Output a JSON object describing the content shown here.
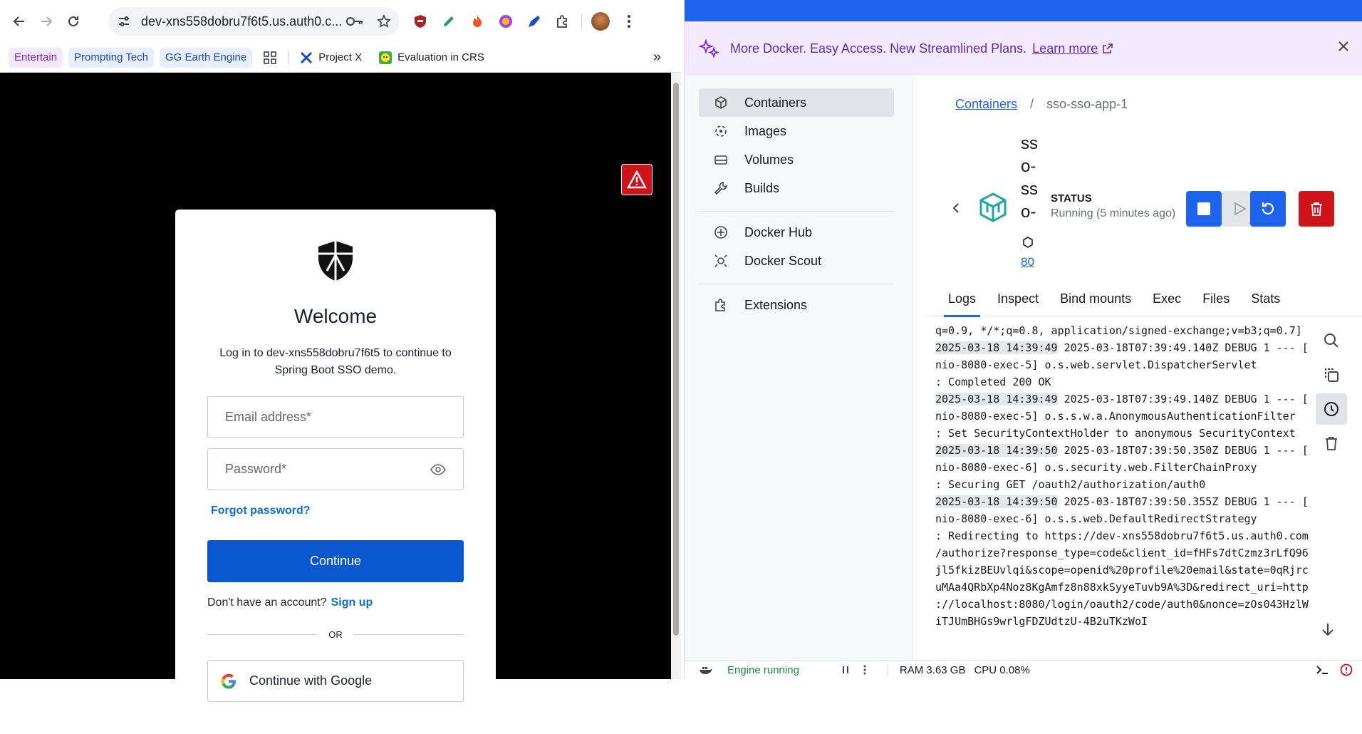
{
  "browser": {
    "url": "dev-xns558dobru7f6t5.us.auth0.c...",
    "bookmarks": [
      {
        "label": "Entertain",
        "style": "purple"
      },
      {
        "label": "Prompting Tech",
        "style": "tag"
      },
      {
        "label": "GG Earth Engine",
        "style": "tag"
      },
      {
        "label": "Project X",
        "style": "icon"
      },
      {
        "label": "Evaluation in CRS",
        "style": "icon"
      }
    ],
    "more_bookmarks": "»"
  },
  "login": {
    "title": "Welcome",
    "subtitle": "Log in to dev-xns558dobru7f6t5 to continue to Spring Boot SSO demo.",
    "email_placeholder": "Email address*",
    "password_placeholder": "Password*",
    "forgot": "Forgot password?",
    "continue": "Continue",
    "no_account": "Don't have an account?",
    "signup": "Sign up",
    "or": "OR",
    "google": "Continue with Google"
  },
  "docker": {
    "banner_text": "More Docker. Easy Access. New Streamlined Plans.",
    "banner_link": "Learn more",
    "nav": {
      "containers": "Containers",
      "images": "Images",
      "volumes": "Volumes",
      "builds": "Builds",
      "hub": "Docker Hub",
      "scout": "Docker Scout",
      "extensions": "Extensions"
    },
    "breadcrumb": {
      "root": "Containers",
      "sep": "/",
      "current": "sso-sso-app-1"
    },
    "container_name": "sso-sso-app-1",
    "port": "80",
    "status_label": "STATUS",
    "status_value": "Running (5 minutes ago)",
    "tabs": [
      "Logs",
      "Inspect",
      "Bind mounts",
      "Exec",
      "Files",
      "Stats"
    ],
    "logs": [
      {
        "ts": "",
        "text": "q=0.9, */*;q=0.8, application/signed-exchange;v=b3;q=0.7]"
      },
      {
        "ts": "2025-03-18 14:39:49",
        "text": " 2025-03-18T07:39:49.140Z DEBUG 1 --- ["
      },
      {
        "ts": "",
        "text": "nio-8080-exec-5] o.s.web.servlet.DispatcherServlet"
      },
      {
        "ts": "",
        "text": ": Completed 200 OK"
      },
      {
        "ts": "2025-03-18 14:39:49",
        "text": " 2025-03-18T07:39:49.140Z DEBUG 1 --- ["
      },
      {
        "ts": "",
        "text": "nio-8080-exec-5] o.s.s.w.a.AnonymousAuthenticationFilter"
      },
      {
        "ts": "",
        "text": ": Set SecurityContextHolder to anonymous SecurityContext"
      },
      {
        "ts": "2025-03-18 14:39:50",
        "text": " 2025-03-18T07:39:50.350Z DEBUG 1 --- ["
      },
      {
        "ts": "",
        "text": "nio-8080-exec-6] o.s.security.web.FilterChainProxy"
      },
      {
        "ts": "",
        "text": ": Securing GET /oauth2/authorization/auth0"
      },
      {
        "ts": "2025-03-18 14:39:50",
        "text": " 2025-03-18T07:39:50.355Z DEBUG 1 --- ["
      },
      {
        "ts": "",
        "text": "nio-8080-exec-6] o.s.s.web.DefaultRedirectStrategy"
      },
      {
        "ts": "",
        "text": ": Redirecting to https://dev-xns558dobru7f6t5.us.auth0.com"
      },
      {
        "ts": "",
        "text": "/authorize?response_type=code&client_id=fHFs7dtCzmz3rLfQ96"
      },
      {
        "ts": "",
        "text": "jl5fkizBEUvlqi&scope=openid%20profile%20email&state=0qRjrc"
      },
      {
        "ts": "",
        "text": "uMAa4QRbXp4Noz8KgAmfz8n88xkSyyeTuvb9A%3D&redirect_uri=http"
      },
      {
        "ts": "",
        "text": "://localhost:8080/login/oauth2/code/auth0&nonce=zOs043HzlW"
      },
      {
        "ts": "",
        "text": "iTJUmBHGs9wrlgFDZUdtzU-4B2uTKzWoI"
      }
    ],
    "status": {
      "engine": "Engine running",
      "ram": "RAM 3.63 GB",
      "cpu": "CPU 0.08%"
    }
  },
  "colors": {
    "docker_blue": "#1d63ed",
    "auth0_blue": "#0b57d0",
    "danger": "#d0121b"
  }
}
